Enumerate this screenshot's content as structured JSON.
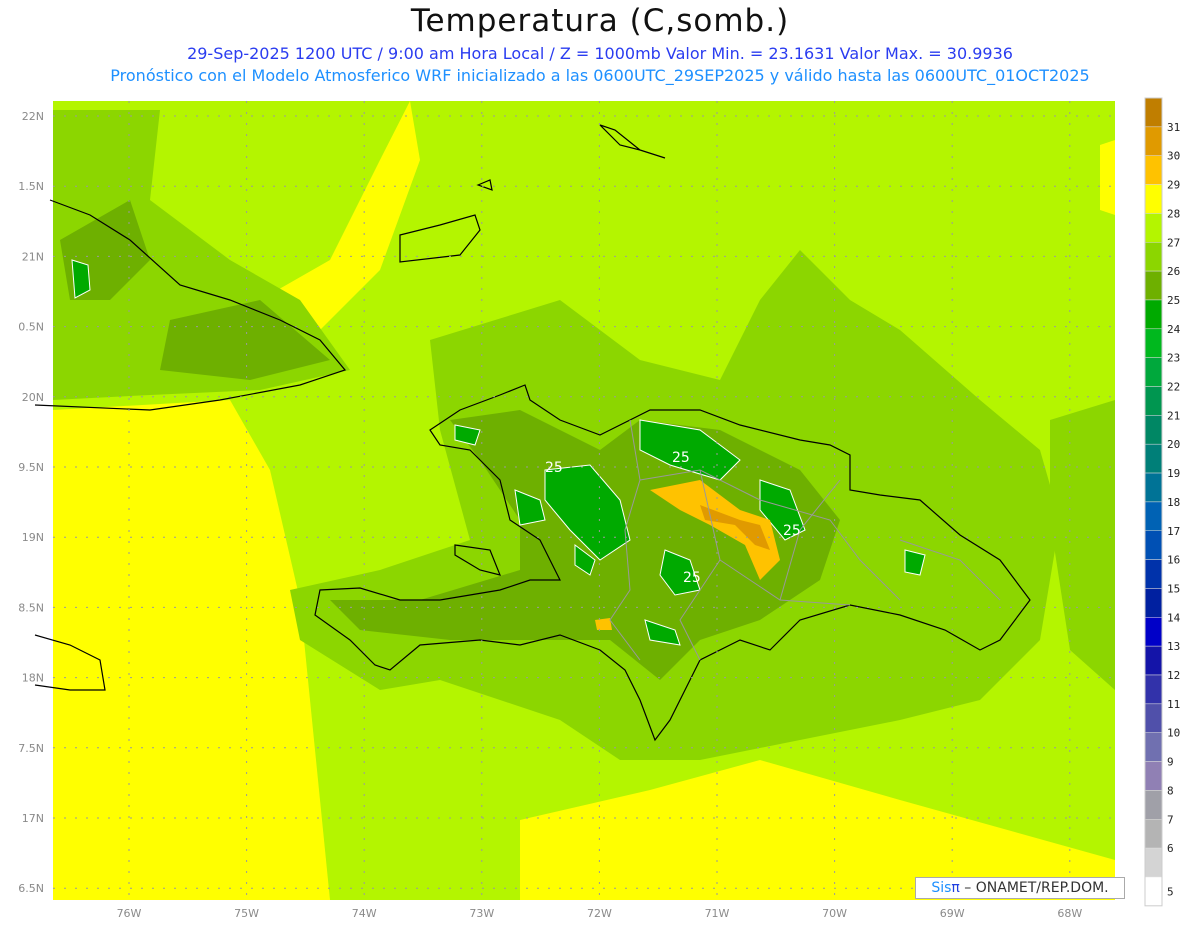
{
  "title": "Temperatura (C,somb.)",
  "subtitle_1": "29-Sep-2025  1200 UTC / 9:00 am Hora Local / Z = 1000mb   Valor Min. = 23.1631  Valor Max. = 30.9936",
  "subtitle_2": "Pronóstico con el Modelo Atmosferico WRF inicializado a las 0600UTC_29SEP2025 y válido hasta las  0600UTC_01OCT2025",
  "lon_labels": [
    "76W",
    "75W",
    "74W",
    "73W",
    "72W",
    "71W",
    "70W",
    "69W",
    "68W"
  ],
  "lat_labels": [
    "22N",
    "1.5N",
    "21N",
    "0.5N",
    "20N",
    "9.5N",
    "19N",
    "8.5N",
    "18N",
    "7.5N",
    "17N",
    "6.5N"
  ],
  "contour_labels": [
    "25",
    "25",
    "25",
    "25"
  ],
  "colorbar": {
    "labels": [
      "31",
      "30",
      "29",
      "28",
      "27",
      "26",
      "25",
      "24",
      "23",
      "22",
      "21",
      "20",
      "19",
      "18",
      "17",
      "16",
      "15",
      "14",
      "13",
      "12",
      "11",
      "10",
      "9",
      "8",
      "7",
      "6",
      "5"
    ],
    "colors": [
      "#c07e00",
      "#e09a00",
      "#ffc200",
      "#ffff00",
      "#b4f500",
      "#8cd600",
      "#6eb000",
      "#00aa00",
      "#00b81e",
      "#00a83c",
      "#009650",
      "#008764",
      "#007f78",
      "#007396",
      "#0062b4",
      "#0050b4",
      "#0032aa",
      "#0020a0",
      "#0000c8",
      "#1414a8",
      "#3232aa",
      "#5050aa",
      "#7070b0",
      "#9080b4",
      "#a0a0a8",
      "#b4b4b4",
      "#d4d4d4",
      "#ffffff"
    ]
  },
  "credit": {
    "sis": "Sis",
    "pi": "π",
    "text": " – ONAMET/REP.DOM."
  }
}
